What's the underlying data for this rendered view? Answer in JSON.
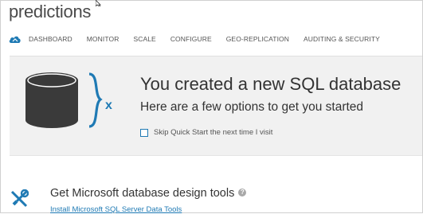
{
  "header": {
    "title": "predictions"
  },
  "nav": {
    "items": [
      {
        "label": "DASHBOARD"
      },
      {
        "label": "MONITOR"
      },
      {
        "label": "SCALE"
      },
      {
        "label": "CONFIGURE"
      },
      {
        "label": "GEO-REPLICATION"
      },
      {
        "label": "AUDITING & SECURITY"
      }
    ]
  },
  "hero": {
    "title": "You created a new SQL database",
    "subtitle": "Here are a few options to get you started",
    "skip_label": "Skip Quick Start the next time I visit",
    "icon_symbol": "x"
  },
  "section": {
    "title": "Get Microsoft database design tools",
    "link": "Install Microsoft SQL Server Data Tools"
  },
  "colors": {
    "accent": "#1f7ab4",
    "hero_background": "#f1f1f1",
    "db_icon": "#3a3a3a"
  }
}
